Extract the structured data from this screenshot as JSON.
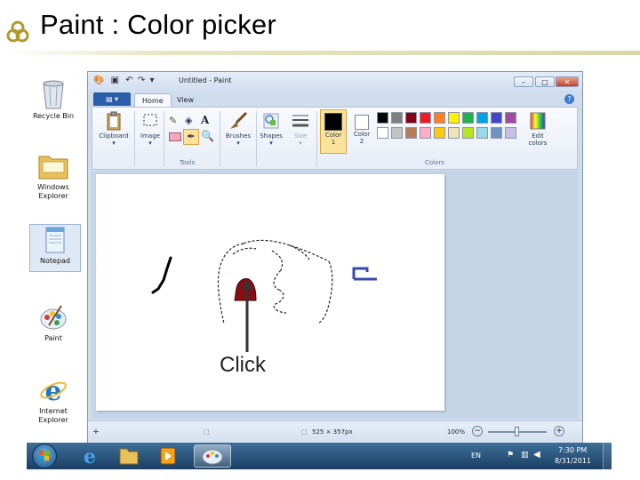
{
  "slide": {
    "title": "Paint : Color picker"
  },
  "desktop": {
    "icons": [
      {
        "label_lines": [
          "Recycle Bin"
        ]
      },
      {
        "label_lines": [
          "Windows",
          "Explorer"
        ]
      },
      {
        "label_lines": [
          "Notepad"
        ]
      },
      {
        "label_lines": [
          "Paint"
        ]
      },
      {
        "label_lines": [
          "Internet",
          "Explorer"
        ]
      }
    ]
  },
  "window": {
    "title": "Untitled - Paint",
    "tabs": [
      "Home",
      "View"
    ],
    "ribbon": {
      "clipboard": "Clipboard",
      "image": "Image",
      "tools_group": "Tools",
      "brushes": "Brushes",
      "shapes": "Shapes",
      "size": "Size",
      "color1": [
        "Color",
        "1"
      ],
      "color2": [
        "Color",
        "2"
      ],
      "edit_colors": [
        "Edit",
        "colors"
      ],
      "colors_group": "Colors"
    },
    "palette_row1": [
      "#000000",
      "#7f7f7f",
      "#880015",
      "#ed1c24",
      "#ff7f27",
      "#fff200",
      "#22b14c",
      "#00a2e8",
      "#3f48cc",
      "#a349a4"
    ],
    "palette_row2": [
      "#ffffff",
      "#c3c3c3",
      "#b97a57",
      "#ffaec9",
      "#ffc90e",
      "#efe4b0",
      "#b5e61d",
      "#99d9ea",
      "#7092be",
      "#c8bfe7"
    ],
    "color1_value": "#000000",
    "color2_value": "#ffffff",
    "picked_color": "#8b0d14",
    "annotation": "Click",
    "status": {
      "dimensions": "525 × 357px",
      "zoom": "100%"
    }
  },
  "taskbar": {
    "lang": "EN",
    "time": "7:30 PM",
    "date": "8/31/2011"
  }
}
